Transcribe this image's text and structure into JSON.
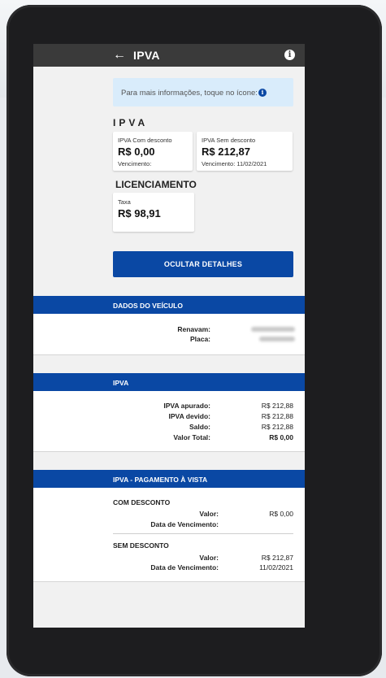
{
  "appbar": {
    "title": "IPVA",
    "back_icon": "arrow-left-icon",
    "info_icon": "info-icon"
  },
  "info_banner": {
    "text": "Para mais informações, toque no ícone:"
  },
  "ipva_section": {
    "title": "IPVA",
    "com_desconto": {
      "label": "IPVA Com desconto",
      "value": "R$ 0,00",
      "due": "Vencimento:"
    },
    "sem_desconto": {
      "label": "IPVA Sem desconto",
      "value": "R$ 212,87",
      "due": "Vencimento: 11/02/2021"
    }
  },
  "licenciamento": {
    "title": "LICENCIAMENTO",
    "label": "Taxa",
    "value": "R$ 98,91"
  },
  "toggle_button": {
    "label": "OCULTAR DETALHES"
  },
  "dados_veiculo": {
    "header": "DADOS DO VEÍCULO",
    "renavam_label": "Renavam:",
    "placa_label": "Placa:"
  },
  "ipva_detail": {
    "header": "IPVA",
    "rows": [
      {
        "label": "IPVA apurado:",
        "value": "R$ 212,88"
      },
      {
        "label": "IPVA devido:",
        "value": "R$ 212,88"
      },
      {
        "label": "Saldo:",
        "value": "R$ 212,88"
      },
      {
        "label": "Valor Total:",
        "value": "R$ 0,00"
      }
    ]
  },
  "pagamento": {
    "header": "IPVA - PAGAMENTO À VISTA",
    "com_desconto": {
      "title": "COM DESCONTO",
      "valor_label": "Valor:",
      "valor": "R$ 0,00",
      "data_label": "Data de Vencimento:",
      "data": ""
    },
    "sem_desconto": {
      "title": "SEM DESCONTO",
      "valor_label": "Valor:",
      "valor": "R$ 212,87",
      "data_label": "Data de Vencimento:",
      "data": "11/02/2021"
    }
  },
  "colors": {
    "primary": "#0a48a4",
    "appbar": "#3a3a3a",
    "info_bg": "#d9ecfb"
  }
}
